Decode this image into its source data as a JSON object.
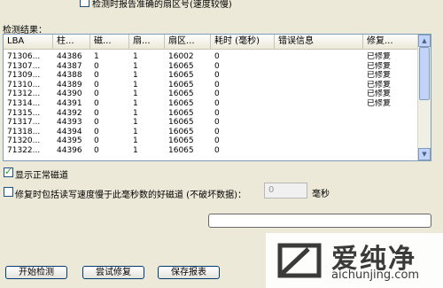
{
  "top_option": {
    "label": "检测时报告准确的扇区号(速度较慢)",
    "checked": false
  },
  "results_label": "检测结果：",
  "table": {
    "columns": [
      "LBA",
      "柱...",
      "磁...",
      "扇...",
      "扇区...",
      "耗时 (毫秒)",
      "错误信息",
      "修复..."
    ],
    "rows": [
      [
        "71306...",
        "44386",
        "1",
        "1",
        "16002",
        "0",
        "",
        "已修复"
      ],
      [
        "71307...",
        "44387",
        "0",
        "1",
        "16065",
        "0",
        "",
        "已修复"
      ],
      [
        "71309...",
        "44388",
        "0",
        "1",
        "16065",
        "0",
        "",
        "已修复"
      ],
      [
        "71310...",
        "44389",
        "0",
        "1",
        "16065",
        "0",
        "",
        "已修复"
      ],
      [
        "71312...",
        "44390",
        "0",
        "1",
        "16065",
        "0",
        "",
        "已修复"
      ],
      [
        "71314...",
        "44391",
        "0",
        "1",
        "16065",
        "0",
        "",
        "已修复"
      ],
      [
        "71315...",
        "44392",
        "0",
        "1",
        "16065",
        "0",
        "",
        ""
      ],
      [
        "71317...",
        "44393",
        "0",
        "1",
        "16065",
        "0",
        "",
        ""
      ],
      [
        "71318...",
        "44394",
        "0",
        "1",
        "16065",
        "0",
        "",
        ""
      ],
      [
        "71320...",
        "44395",
        "0",
        "1",
        "16065",
        "0",
        "",
        ""
      ],
      [
        "71322...",
        "44396",
        "0",
        "1",
        "16065",
        "0",
        "",
        ""
      ]
    ]
  },
  "show_normal": {
    "label": "显示正常磁道",
    "checked": true
  },
  "repair_slow": {
    "label": "修复时包括读写速度慢于此毫秒数的好磁道 (不破坏数据)：",
    "checked": false,
    "value": "0",
    "unit": "毫秒"
  },
  "buttons": {
    "start": "开始检测",
    "try_repair": "尝试修复",
    "save_report": "保存报表"
  },
  "watermark": {
    "cn": "爱纯净",
    "url": "aichunjing.com"
  },
  "colors": {
    "accent": "#1c5180",
    "watermark_logo": "#3a3a3a"
  }
}
